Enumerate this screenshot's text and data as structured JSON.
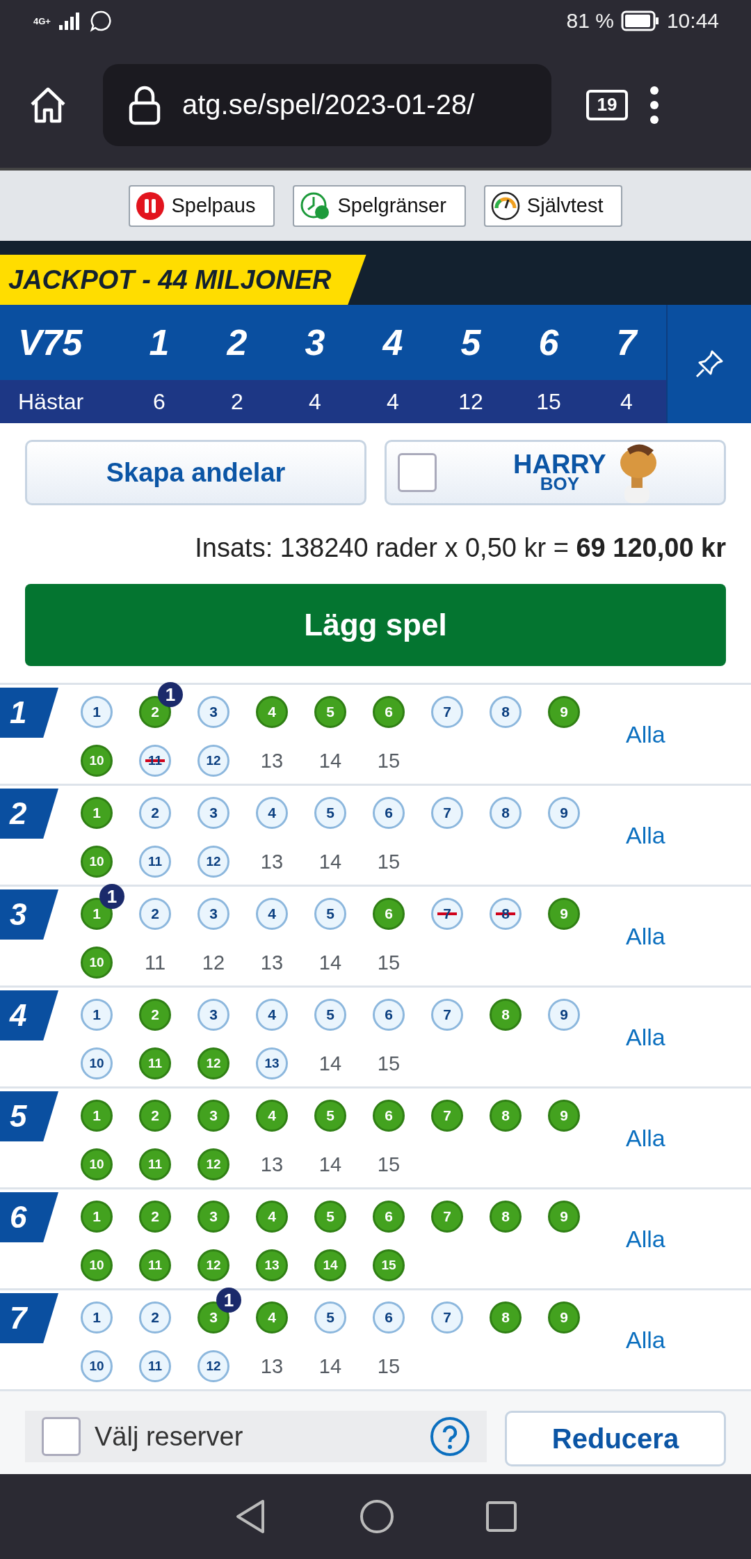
{
  "status_bar": {
    "network": "4G+",
    "battery": "81 %",
    "time": "10:44"
  },
  "browser": {
    "url": "atg.se/spel/2023-01-28/",
    "tab_count": "19"
  },
  "responsible_gaming": [
    {
      "kind": "pause",
      "label": "Spelpaus"
    },
    {
      "kind": "limits",
      "label": "Spelgränser"
    },
    {
      "kind": "test",
      "label": "Självtest"
    }
  ],
  "jackpot": "JACKPOT - 44 MILJONER",
  "game": {
    "name": "V75",
    "horses_label": "Hästar",
    "legs": [
      {
        "number": "1",
        "horses": "6"
      },
      {
        "number": "2",
        "horses": "2"
      },
      {
        "number": "3",
        "horses": "4"
      },
      {
        "number": "4",
        "horses": "4"
      },
      {
        "number": "5",
        "horses": "12"
      },
      {
        "number": "6",
        "horses": "15"
      },
      {
        "number": "7",
        "horses": "4"
      }
    ]
  },
  "actions": {
    "shares_button": "Skapa andelar",
    "harry_boy": {
      "checked": false,
      "logo_top": "HARRY",
      "logo_bottom": "BOY"
    }
  },
  "stake": "Insats: 138240 rader x 0,50 kr = **69 120,00 kr**",
  "place_bet": "Lägg spel",
  "races": [
    {
      "number": "1",
      "all_label": "Alla",
      "horses": [
        {
          "number": "1",
          "kind": "runner",
          "selected": false
        },
        {
          "number": "2",
          "kind": "runner",
          "selected": true,
          "badge": "1"
        },
        {
          "number": "3",
          "kind": "runner",
          "selected": false
        },
        {
          "number": "4",
          "kind": "runner",
          "selected": true
        },
        {
          "number": "5",
          "kind": "runner",
          "selected": true
        },
        {
          "number": "6",
          "kind": "runner",
          "selected": true
        },
        {
          "number": "7",
          "kind": "runner",
          "selected": false
        },
        {
          "number": "8",
          "kind": "runner",
          "selected": false
        },
        {
          "number": "9",
          "kind": "runner",
          "selected": true
        },
        {
          "number": "10",
          "kind": "runner",
          "selected": true
        },
        {
          "number": "11",
          "kind": "scratched"
        },
        {
          "number": "12",
          "kind": "runner",
          "selected": false
        },
        {
          "number": "13",
          "kind": "empty"
        },
        {
          "number": "14",
          "kind": "empty"
        },
        {
          "number": "15",
          "kind": "empty"
        }
      ]
    },
    {
      "number": "2",
      "all_label": "Alla",
      "horses": [
        {
          "number": "1",
          "kind": "runner",
          "selected": true
        },
        {
          "number": "2",
          "kind": "runner",
          "selected": false
        },
        {
          "number": "3",
          "kind": "runner",
          "selected": false
        },
        {
          "number": "4",
          "kind": "runner",
          "selected": false
        },
        {
          "number": "5",
          "kind": "runner",
          "selected": false
        },
        {
          "number": "6",
          "kind": "runner",
          "selected": false
        },
        {
          "number": "7",
          "kind": "runner",
          "selected": false
        },
        {
          "number": "8",
          "kind": "runner",
          "selected": false
        },
        {
          "number": "9",
          "kind": "runner",
          "selected": false
        },
        {
          "number": "10",
          "kind": "runner",
          "selected": true
        },
        {
          "number": "11",
          "kind": "runner",
          "selected": false
        },
        {
          "number": "12",
          "kind": "runner",
          "selected": false
        },
        {
          "number": "13",
          "kind": "empty"
        },
        {
          "number": "14",
          "kind": "empty"
        },
        {
          "number": "15",
          "kind": "empty"
        }
      ]
    },
    {
      "number": "3",
      "all_label": "Alla",
      "horses": [
        {
          "number": "1",
          "kind": "runner",
          "selected": true,
          "badge": "1"
        },
        {
          "number": "2",
          "kind": "runner",
          "selected": false
        },
        {
          "number": "3",
          "kind": "runner",
          "selected": false
        },
        {
          "number": "4",
          "kind": "runner",
          "selected": false
        },
        {
          "number": "5",
          "kind": "runner",
          "selected": false
        },
        {
          "number": "6",
          "kind": "runner",
          "selected": true
        },
        {
          "number": "7",
          "kind": "scratched"
        },
        {
          "number": "8",
          "kind": "scratched"
        },
        {
          "number": "9",
          "kind": "runner",
          "selected": true
        },
        {
          "number": "10",
          "kind": "runner",
          "selected": true
        },
        {
          "number": "11",
          "kind": "empty"
        },
        {
          "number": "12",
          "kind": "empty"
        },
        {
          "number": "13",
          "kind": "empty"
        },
        {
          "number": "14",
          "kind": "empty"
        },
        {
          "number": "15",
          "kind": "empty"
        }
      ]
    },
    {
      "number": "4",
      "all_label": "Alla",
      "horses": [
        {
          "number": "1",
          "kind": "runner",
          "selected": false
        },
        {
          "number": "2",
          "kind": "runner",
          "selected": true
        },
        {
          "number": "3",
          "kind": "runner",
          "selected": false
        },
        {
          "number": "4",
          "kind": "runner",
          "selected": false
        },
        {
          "number": "5",
          "kind": "runner",
          "selected": false
        },
        {
          "number": "6",
          "kind": "runner",
          "selected": false
        },
        {
          "number": "7",
          "kind": "runner",
          "selected": false
        },
        {
          "number": "8",
          "kind": "runner",
          "selected": true
        },
        {
          "number": "9",
          "kind": "runner",
          "selected": false
        },
        {
          "number": "10",
          "kind": "runner",
          "selected": false
        },
        {
          "number": "11",
          "kind": "runner",
          "selected": true
        },
        {
          "number": "12",
          "kind": "runner",
          "selected": true
        },
        {
          "number": "13",
          "kind": "runner",
          "selected": false
        },
        {
          "number": "14",
          "kind": "empty"
        },
        {
          "number": "15",
          "kind": "empty"
        }
      ]
    },
    {
      "number": "5",
      "all_label": "Alla",
      "horses": [
        {
          "number": "1",
          "kind": "runner",
          "selected": true
        },
        {
          "number": "2",
          "kind": "runner",
          "selected": true
        },
        {
          "number": "3",
          "kind": "runner",
          "selected": true
        },
        {
          "number": "4",
          "kind": "runner",
          "selected": true
        },
        {
          "number": "5",
          "kind": "runner",
          "selected": true
        },
        {
          "number": "6",
          "kind": "runner",
          "selected": true
        },
        {
          "number": "7",
          "kind": "runner",
          "selected": true
        },
        {
          "number": "8",
          "kind": "runner",
          "selected": true
        },
        {
          "number": "9",
          "kind": "runner",
          "selected": true
        },
        {
          "number": "10",
          "kind": "runner",
          "selected": true
        },
        {
          "number": "11",
          "kind": "runner",
          "selected": true
        },
        {
          "number": "12",
          "kind": "runner",
          "selected": true
        },
        {
          "number": "13",
          "kind": "empty"
        },
        {
          "number": "14",
          "kind": "empty"
        },
        {
          "number": "15",
          "kind": "empty"
        }
      ]
    },
    {
      "number": "6",
      "all_label": "Alla",
      "horses": [
        {
          "number": "1",
          "kind": "runner",
          "selected": true
        },
        {
          "number": "2",
          "kind": "runner",
          "selected": true
        },
        {
          "number": "3",
          "kind": "runner",
          "selected": true
        },
        {
          "number": "4",
          "kind": "runner",
          "selected": true
        },
        {
          "number": "5",
          "kind": "runner",
          "selected": true
        },
        {
          "number": "6",
          "kind": "runner",
          "selected": true
        },
        {
          "number": "7",
          "kind": "runner",
          "selected": true
        },
        {
          "number": "8",
          "kind": "runner",
          "selected": true
        },
        {
          "number": "9",
          "kind": "runner",
          "selected": true
        },
        {
          "number": "10",
          "kind": "runner",
          "selected": true
        },
        {
          "number": "11",
          "kind": "runner",
          "selected": true
        },
        {
          "number": "12",
          "kind": "runner",
          "selected": true
        },
        {
          "number": "13",
          "kind": "runner",
          "selected": true
        },
        {
          "number": "14",
          "kind": "runner",
          "selected": true
        },
        {
          "number": "15",
          "kind": "runner",
          "selected": true
        }
      ]
    },
    {
      "number": "7",
      "all_label": "Alla",
      "horses": [
        {
          "number": "1",
          "kind": "runner",
          "selected": false
        },
        {
          "number": "2",
          "kind": "runner",
          "selected": false
        },
        {
          "number": "3",
          "kind": "runner",
          "selected": true,
          "badge": "1"
        },
        {
          "number": "4",
          "kind": "runner",
          "selected": true
        },
        {
          "number": "5",
          "kind": "runner",
          "selected": false
        },
        {
          "number": "6",
          "kind": "runner",
          "selected": false
        },
        {
          "number": "7",
          "kind": "runner",
          "selected": false
        },
        {
          "number": "8",
          "kind": "runner",
          "selected": true
        },
        {
          "number": "9",
          "kind": "runner",
          "selected": true
        },
        {
          "number": "10",
          "kind": "runner",
          "selected": false
        },
        {
          "number": "11",
          "kind": "runner",
          "selected": false
        },
        {
          "number": "12",
          "kind": "runner",
          "selected": false
        },
        {
          "number": "13",
          "kind": "empty"
        },
        {
          "number": "14",
          "kind": "empty"
        },
        {
          "number": "15",
          "kind": "empty"
        }
      ]
    }
  ],
  "reserves": {
    "checked": false,
    "label": "Välj reserver"
  },
  "reduce_button": "Reducera"
}
